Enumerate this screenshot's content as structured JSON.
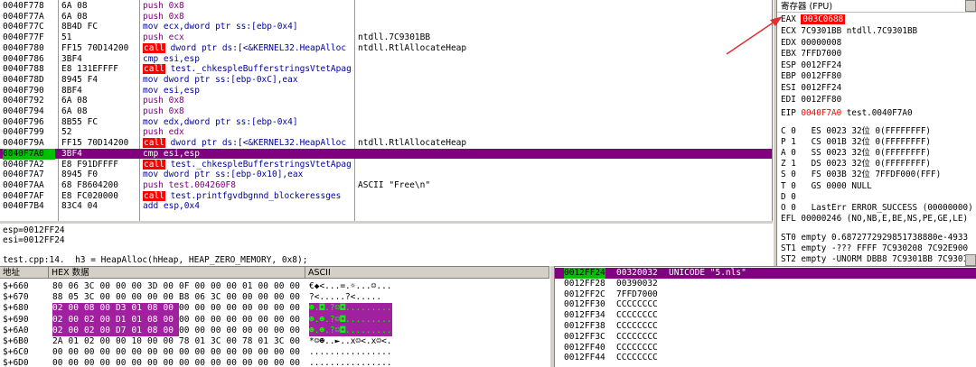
{
  "disasm": {
    "rows": [
      {
        "addr": "0040F778",
        "hex": "6A 08",
        "asm": "push 0x8",
        "cmt": "",
        "kind": "pushmag"
      },
      {
        "addr": "0040F77A",
        "hex": "6A 08",
        "asm": "push 0x8",
        "cmt": "",
        "kind": "pushmag"
      },
      {
        "addr": "0040F77C",
        "hex": "8B4D FC",
        "asm": "mov ecx,dword ptr ss:[ebp-0x4]",
        "cmt": "",
        "kind": "mov"
      },
      {
        "addr": "0040F77F",
        "hex": "51",
        "asm": "push ecx",
        "cmt": "ntdll.7C9301BB",
        "kind": "pushmag"
      },
      {
        "addr": "0040F780",
        "hex": "FF15 70D14200",
        "asm": "dword ptr ds:[<&KERNEL32.HeapAlloc",
        "cmt": "ntdll.RtlAllocateHeap",
        "kind": "call"
      },
      {
        "addr": "0040F786",
        "hex": "3BF4",
        "asm": "cmp esi,esp",
        "cmt": "",
        "kind": "mov"
      },
      {
        "addr": "0040F788",
        "hex": "E8 131EFFFF",
        "asm": "test._chkespleBufferstringsVtetApag",
        "cmt": "",
        "kind": "call"
      },
      {
        "addr": "0040F78D",
        "hex": "8945 F4",
        "asm": "mov dword ptr ss:[ebp-0xC],eax",
        "cmt": "",
        "kind": "mov"
      },
      {
        "addr": "0040F790",
        "hex": "8BF4",
        "asm": "mov esi,esp",
        "cmt": "",
        "kind": "mov"
      },
      {
        "addr": "0040F792",
        "hex": "6A 08",
        "asm": "push 0x8",
        "cmt": "",
        "kind": "pushmag"
      },
      {
        "addr": "0040F794",
        "hex": "6A 08",
        "asm": "push 0x8",
        "cmt": "",
        "kind": "pushmag"
      },
      {
        "addr": "0040F796",
        "hex": "8B55 FC",
        "asm": "mov edx,dword ptr ss:[ebp-0x4]",
        "cmt": "",
        "kind": "mov"
      },
      {
        "addr": "0040F799",
        "hex": "52",
        "asm": "push edx",
        "cmt": "",
        "kind": "pushmag"
      },
      {
        "addr": "0040F79A",
        "hex": "FF15 70D14200",
        "asm": "dword ptr ds:[<&KERNEL32.HeapAlloc",
        "cmt": "ntdll.RtlAllocateHeap",
        "kind": "call"
      },
      {
        "addr": "0040F7A0",
        "hex": "3BF4",
        "asm": "cmp esi,esp",
        "cmt": "",
        "kind": "hl"
      },
      {
        "addr": "0040F7A2",
        "hex": "E8 F91DFFFF",
        "asm": "test._chkespleBufferstringsVtetApag",
        "cmt": "",
        "kind": "call"
      },
      {
        "addr": "0040F7A7",
        "hex": "8945 F0",
        "asm": "mov dword ptr ss:[ebp-0x10],eax",
        "cmt": "",
        "kind": "mov"
      },
      {
        "addr": "0040F7AA",
        "hex": "68 F8604200",
        "asm": "push test.004260F8",
        "cmt": "ASCII \"Free\\n\"",
        "kind": "pushmag"
      },
      {
        "addr": "0040F7AF",
        "hex": "E8 FC020000",
        "asm": "test.printfgvdbgnnd_blockeressges",
        "cmt": "",
        "kind": "call"
      },
      {
        "addr": "0040F7B4",
        "hex": "83C4 04",
        "asm": "add esp,0x4",
        "cmt": "",
        "kind": "mov"
      }
    ]
  },
  "registers": {
    "title": "寄存器 (FPU)",
    "eax": {
      "name": "EAX",
      "value": "003C0688"
    },
    "lines": [
      {
        "n": "ECX",
        "v": "7C9301BB",
        "c": "ntdll.7C9301BB"
      },
      {
        "n": "EDX",
        "v": "00000008",
        "c": ""
      },
      {
        "n": "EBX",
        "v": "7FFD7000",
        "c": ""
      },
      {
        "n": "ESP",
        "v": "0012FF24",
        "c": ""
      },
      {
        "n": "EBP",
        "v": "0012FF80",
        "c": ""
      },
      {
        "n": "ESI",
        "v": "0012FF24",
        "c": ""
      },
      {
        "n": "EDI",
        "v": "0012FF80",
        "c": ""
      }
    ],
    "eip": {
      "n": "EIP",
      "v": "0040F7A0",
      "c": "test.0040F7A0"
    },
    "flags": [
      "C 0   ES 0023 32位 0(FFFFFFFF)",
      "P 1   CS 001B 32位 0(FFFFFFFF)",
      "A 0   SS 0023 32位 0(FFFFFFFF)",
      "Z 1   DS 0023 32位 0(FFFFFFFF)",
      "S 0   FS 003B 32位 7FFDF000(FFF)",
      "T 0   GS 0000 NULL",
      "D 0",
      "O 0   LastErr ERROR_SUCCESS (00000000)"
    ],
    "efl": "EFL 00000246 (NO,NB,E,BE,NS,PE,GE,LE)",
    "st": [
      "ST0 empty 0.6872772929851738880e-4933",
      "ST1 empty -??? FFFF 7C930208 7C92E900",
      "ST2 empty -UNORM DBB8 7C9301BB 7C9301"
    ]
  },
  "info": {
    "line1": "esp=0012FF24",
    "line2": "esi=0012FF24",
    "line3": "test.cpp:14.  h3 = HeapAlloc(hHeap, HEAP_ZERO_MEMORY, 0x8);"
  },
  "dump": {
    "head_addr": "地址",
    "head_hex": "HEX 数据",
    "head_ascii": "ASCII",
    "rows": [
      {
        "addr": "$+660",
        "hex": [
          "80",
          "06",
          "3C",
          "00",
          "00",
          "00",
          "3D",
          "00",
          "0F",
          "00",
          "00",
          "00",
          "01",
          "00",
          "00",
          "00"
        ],
        "asc": "€◆<...=.☼...☺...",
        "mag": []
      },
      {
        "addr": "$+670",
        "hex": [
          "88",
          "05",
          "3C",
          "00",
          "00",
          "00",
          "00",
          "00",
          "B8",
          "06",
          "3C",
          "00",
          "00",
          "00",
          "00",
          "00"
        ],
        "asc": "?<.....?<.....",
        "mag": []
      },
      {
        "addr": "$+680",
        "hex": [
          "02",
          "00",
          "08",
          "00",
          "D3",
          "01",
          "08",
          "00",
          "00",
          "00",
          "00",
          "00",
          "00",
          "00",
          "00",
          "00"
        ],
        "asc": "☻.◘.?☺◘.........",
        "mag": [
          0,
          1,
          2,
          3,
          4,
          5,
          6,
          7
        ]
      },
      {
        "addr": "$+690",
        "hex": [
          "02",
          "00",
          "02",
          "00",
          "D1",
          "01",
          "08",
          "00",
          "00",
          "00",
          "00",
          "00",
          "00",
          "00",
          "00",
          "00"
        ],
        "asc": "☻.☻.?☺◘.........",
        "mag": [
          0,
          1,
          2,
          3,
          4,
          5,
          6,
          7
        ]
      },
      {
        "addr": "$+6A0",
        "hex": [
          "02",
          "00",
          "02",
          "00",
          "D7",
          "01",
          "08",
          "00",
          "00",
          "00",
          "00",
          "00",
          "00",
          "00",
          "00",
          "00"
        ],
        "asc": "☻.☻.?☺◘.........",
        "mag": [
          0,
          1,
          2,
          3,
          4,
          5,
          6,
          7
        ]
      },
      {
        "addr": "$+6B0",
        "hex": [
          "2A",
          "01",
          "02",
          "00",
          "00",
          "10",
          "00",
          "00",
          "78",
          "01",
          "3C",
          "00",
          "78",
          "01",
          "3C",
          "00"
        ],
        "asc": "*☺☻..►..x☺<.x☺<.",
        "mag": []
      },
      {
        "addr": "$+6C0",
        "hex": [
          "00",
          "00",
          "00",
          "00",
          "00",
          "00",
          "00",
          "00",
          "00",
          "00",
          "00",
          "00",
          "00",
          "00",
          "00",
          "00"
        ],
        "asc": "................",
        "mag": []
      },
      {
        "addr": "$+6D0",
        "hex": [
          "00",
          "00",
          "00",
          "00",
          "00",
          "00",
          "00",
          "00",
          "00",
          "00",
          "00",
          "00",
          "00",
          "00",
          "00",
          "00"
        ],
        "asc": "................",
        "mag": []
      }
    ]
  },
  "stack": {
    "rows": [
      {
        "addr": "0012FF24",
        "val": "00320032",
        "cmt": "UNICODE \"5.nls\"",
        "hl": true
      },
      {
        "addr": "0012FF28",
        "val": "00390032",
        "cmt": "",
        "hl": false
      },
      {
        "addr": "0012FF2C",
        "val": "7FFD7000",
        "cmt": "",
        "hl": false
      },
      {
        "addr": "0012FF30",
        "val": "CCCCCCCC",
        "cmt": "",
        "hl": false
      },
      {
        "addr": "0012FF34",
        "val": "CCCCCCCC",
        "cmt": "",
        "hl": false
      },
      {
        "addr": "0012FF38",
        "val": "CCCCCCCC",
        "cmt": "",
        "hl": false
      },
      {
        "addr": "0012FF3C",
        "val": "CCCCCCCC",
        "cmt": "",
        "hl": false
      },
      {
        "addr": "0012FF40",
        "val": "CCCCCCCC",
        "cmt": "",
        "hl": false
      },
      {
        "addr": "0012FF44",
        "val": "CCCCCCCC",
        "cmt": "",
        "hl": false
      }
    ]
  }
}
